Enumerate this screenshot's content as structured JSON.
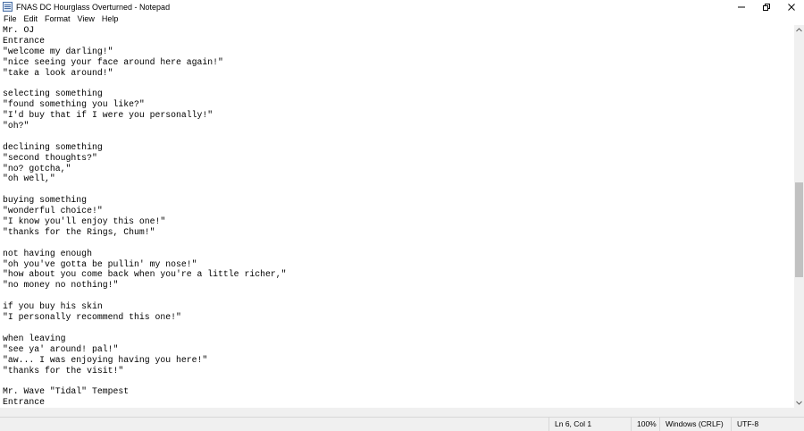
{
  "window": {
    "title": "FNAS DC Hourglass Overturned - Notepad",
    "app_icon": "notepad-icon",
    "controls": [
      "minimize-icon",
      "restore-icon",
      "close-icon"
    ]
  },
  "menu": {
    "items": [
      "File",
      "Edit",
      "Format",
      "View",
      "Help"
    ]
  },
  "editor": {
    "lines": [
      "Mr. OJ",
      "Entrance",
      "\"welcome my darling!\"",
      "\"nice seeing your face around here again!\"",
      "\"take a look around!\"",
      "",
      "selecting something",
      "\"found something you like?\"",
      "\"I'd buy that if I were you personally!\"",
      "\"oh?\"",
      "",
      "declining something",
      "\"second thoughts?\"",
      "\"no? gotcha,\"",
      "\"oh well,\"",
      "",
      "buying something",
      "\"wonderful choice!\"",
      "\"I know you'll enjoy this one!\"",
      "\"thanks for the Rings, Chum!\"",
      "",
      "not having enough",
      "\"oh you've gotta be pullin' my nose!\"",
      "\"how about you come back when you're a little richer,\"",
      "\"no money no nothing!\"",
      "",
      "if you buy his skin",
      "\"I personally recommend this one!\"",
      "",
      "when leaving",
      "\"see ya' around! pal!\"",
      "\"aw... I was enjoying having you here!\"",
      "\"thanks for the visit!\"",
      "",
      "Mr. Wave \"Tidal\" Tempest",
      "Entrance"
    ]
  },
  "scrollbar": {
    "position_fraction": 0.55
  },
  "status": {
    "position": "Ln 6, Col 1",
    "zoom": "100%",
    "line_ending": "Windows (CRLF)",
    "encoding": "UTF-8"
  }
}
